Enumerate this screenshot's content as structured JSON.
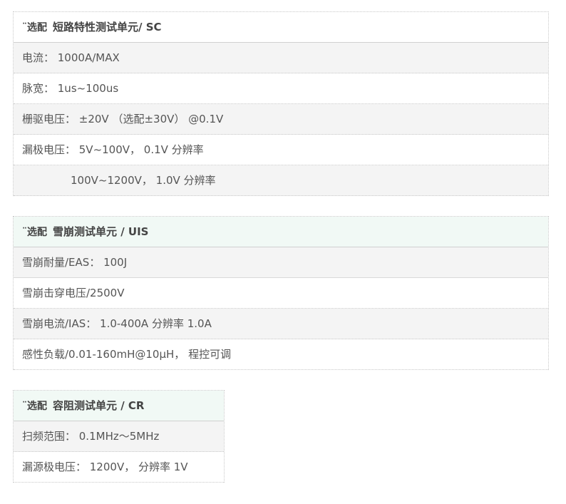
{
  "sc": {
    "title_prefix": "¨选配",
    "title": "短路特性测试单元/ SC",
    "rows": [
      "电流： 1000A/MAX",
      "脉宽： 1us~100us",
      "栅驱电压： ±20V （选配±30V） @0.1V",
      "漏极电压： 5V~100V， 0.1V 分辨率",
      "100V~1200V， 1.0V 分辨率"
    ]
  },
  "uis": {
    "title_prefix": "¨选配",
    "title": "雪崩测试单元 / UIS",
    "rows": [
      "雪崩耐量/EAS： 100J",
      "雪崩击穿电压/2500V",
      "雪崩电流/IAS： 1.0-400A 分辨率 1.0A",
      "感性负载/0.01-160mH@10μH， 程控可调"
    ]
  },
  "cr": {
    "title_prefix": "¨选配",
    "title": "容阻测试单元 / CR",
    "rows": [
      "扫频范围： 0.1MHz～5MHz",
      "漏源极电压： 1200V， 分辨率 1V"
    ]
  }
}
